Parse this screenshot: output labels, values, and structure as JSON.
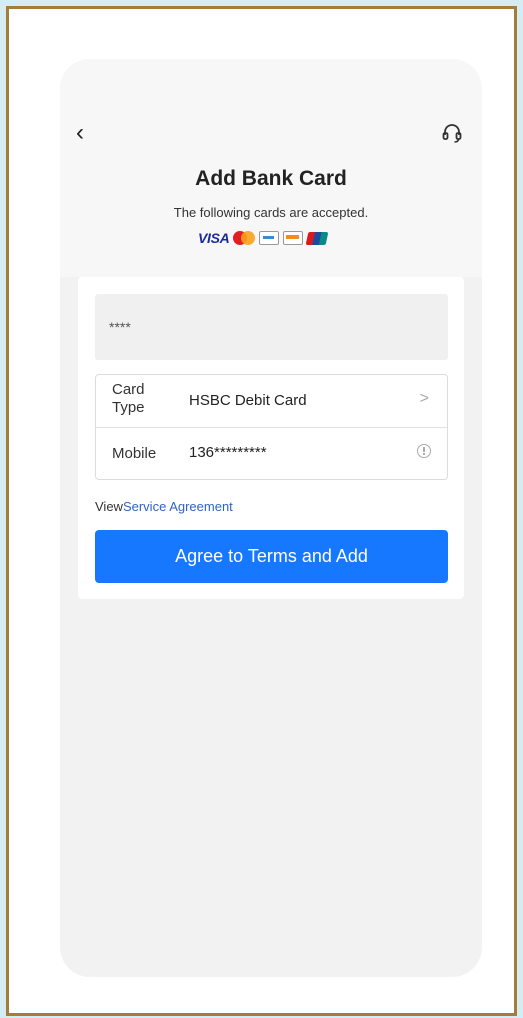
{
  "header": {
    "back_symbol": "‹",
    "title": "Add Bank Card",
    "subtitle": "The following cards are accepted.",
    "accepted_cards": [
      "VISA",
      "mastercard-icon",
      "amex-icon",
      "discover-icon",
      "unionpay-icon"
    ],
    "brand_color": "#1677ff"
  },
  "form": {
    "card_number_value": "****",
    "card_type_label": "Card Type",
    "card_type_value": "HSBC  Debit Card",
    "mobile_label": "Mobile",
    "mobile_value": "136*********"
  },
  "agreement": {
    "prefix": "View",
    "link_text": "Service Agreement"
  },
  "actions": {
    "add_label": "Agree to Terms and Add"
  }
}
